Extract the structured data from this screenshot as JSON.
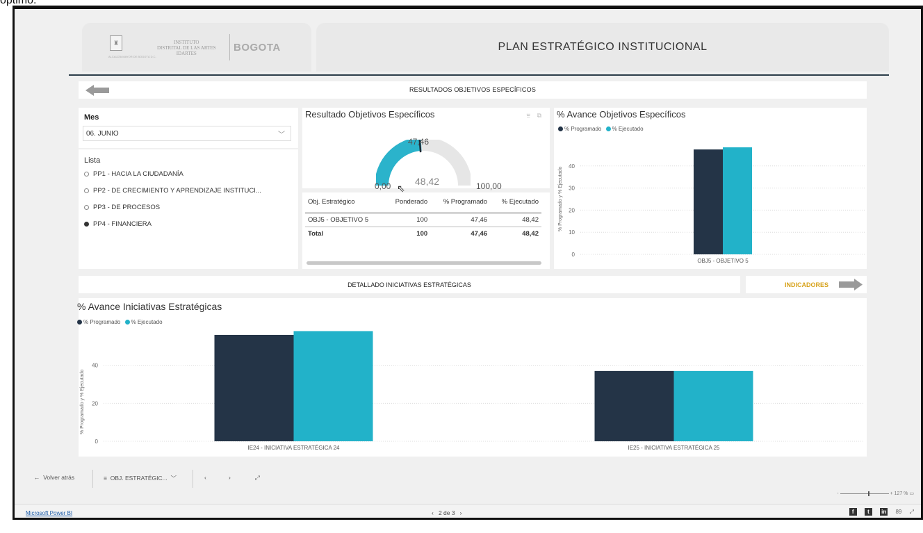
{
  "caption": "optimo.",
  "header": {
    "logo_text_1": "INSTITUTO",
    "logo_text_2": "DISTRITAL DE LAS ARTES",
    "logo_text_3": "IDARTES",
    "logo_small": "ALCALDÍA MAYOR DE BOGOTÁ D.C.",
    "logo_city": "BOGOTA",
    "title": "PLAN ESTRATÉGICO INSTITUCIONAL"
  },
  "nav": {
    "title": "RESULTADOS OBJETIVOS ESPECÍFICOS"
  },
  "filter": {
    "mes_label": "Mes",
    "mes_value": "06. JUNIO",
    "lista_label": "Lista",
    "options": [
      {
        "label": "PP1 - HACIA LA CIUDADANÍA",
        "selected": false
      },
      {
        "label": "PP2 - DE CRECIMIENTO Y APRENDIZAJE INSTITUCI...",
        "selected": false
      },
      {
        "label": "PP3 - DE PROCESOS",
        "selected": false
      },
      {
        "label": "PP4 - FINANCIERA",
        "selected": true
      }
    ]
  },
  "gauge": {
    "title": "Resultado Objetivos Específicos",
    "min": "0,00",
    "max": "100,00",
    "target": "47,46",
    "value": "48,42",
    "value_num": 48.42,
    "target_num": 47.46,
    "color": "#2bb3cb"
  },
  "obj_table": {
    "headers": [
      "Obj. Estratégico",
      "Ponderado",
      "% Programado",
      "% Ejecutado"
    ],
    "rows": [
      [
        "OBJ5 - OBJETIVO 5",
        "100",
        "47,46",
        "48,42"
      ]
    ],
    "total": [
      "Total",
      "100",
      "47,46",
      "48,42"
    ]
  },
  "legend": {
    "programado": "% Programado",
    "ejecutado": "% Ejecutado"
  },
  "colors": {
    "programado": "#243447",
    "ejecutado": "#22b2c9",
    "accent": "#d7a21a"
  },
  "avance_obj_title": "% Avance Objetivos Específicos",
  "avance_ini_title": "% Avance Iniciativas Estratégicas",
  "ylabel": "% Programado y % Ejecutado",
  "detail": {
    "title": "DETALLADO INICIATIVAS ESTRATÉGICAS",
    "indicadores": "INDICADORES"
  },
  "chart_data": [
    {
      "type": "bar",
      "title": "% Avance Objetivos Específicos",
      "categories": [
        "OBJ5 - OBJETIVO 5"
      ],
      "series": [
        {
          "name": "% Programado",
          "values": [
            47.46
          ]
        },
        {
          "name": "% Ejecutado",
          "values": [
            48.42
          ]
        }
      ],
      "ylabel": "% Programado y % Ejecutado",
      "yticks": [
        0,
        10,
        20,
        30,
        40
      ],
      "ylim": [
        0,
        50
      ]
    },
    {
      "type": "bar",
      "title": "% Avance Iniciativas Estratégicas",
      "categories": [
        "IE24 - INICIATIVA ESTRATÉGICA 24",
        "IE25 - INICIATIVA ESTRATÉGICA 25"
      ],
      "series": [
        {
          "name": "% Programado",
          "values": [
            56,
            37
          ]
        },
        {
          "name": "% Ejecutado",
          "values": [
            58,
            37
          ]
        }
      ],
      "ylabel": "% Programado y % Ejecutado",
      "yticks": [
        0,
        20,
        40
      ],
      "ylim": [
        0,
        60
      ]
    }
  ],
  "bottom_nav": {
    "back": "Volver atrás",
    "page_menu": "OBJ. ESTRATÉGIC...",
    "zoom": "127 %"
  },
  "status": {
    "brand": "Microsoft Power BI",
    "pager": "2 de 3"
  }
}
